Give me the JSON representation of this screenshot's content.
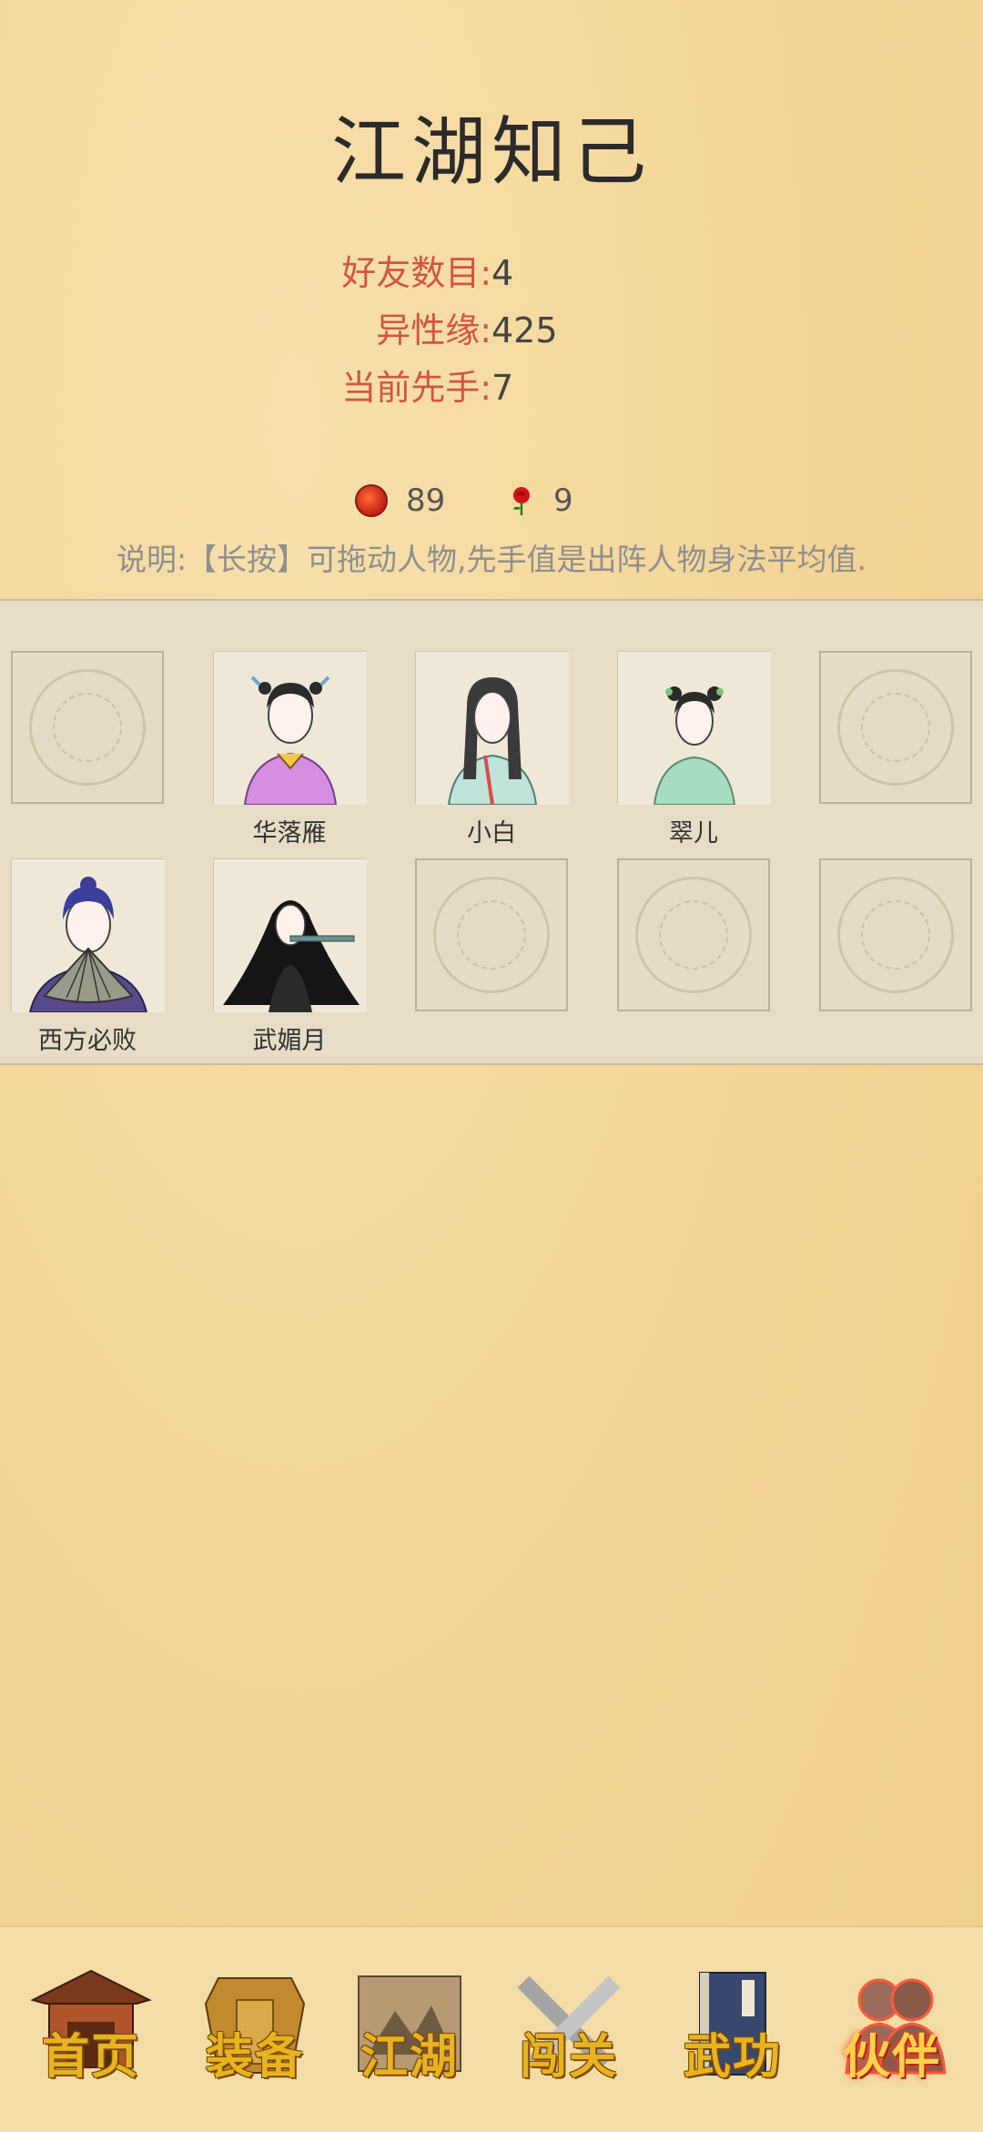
{
  "page": {
    "title": "江湖知己"
  },
  "stats": [
    {
      "label": "好友数目:",
      "value": "4"
    },
    {
      "label": "异性缘:",
      "value": "425"
    },
    {
      "label": "当前先手:",
      "value": "7"
    }
  ],
  "currency": {
    "coins": "89",
    "roses": "9"
  },
  "note": "说明:【长按】可拖动人物,先手值是出阵人物身法平均值.",
  "slots": [
    {
      "name": "",
      "empty": true
    },
    {
      "name": "华落雁",
      "empty": false
    },
    {
      "name": "小白",
      "empty": false
    },
    {
      "name": "翠儿",
      "empty": false
    },
    {
      "name": "",
      "empty": true
    },
    {
      "name": "西方必败",
      "empty": false
    },
    {
      "name": "武媚月",
      "empty": false
    },
    {
      "name": "",
      "empty": true
    },
    {
      "name": "",
      "empty": true
    },
    {
      "name": "",
      "empty": true
    }
  ],
  "nav": [
    {
      "label": "首页",
      "icon": "temple-icon"
    },
    {
      "label": "装备",
      "icon": "armor-icon"
    },
    {
      "label": "江湖",
      "icon": "scroll-map-icon"
    },
    {
      "label": "闯关",
      "icon": "crossed-swords-icon"
    },
    {
      "label": "武功",
      "icon": "book-icon"
    },
    {
      "label": "伙伴",
      "icon": "companions-icon",
      "active": true
    }
  ]
}
